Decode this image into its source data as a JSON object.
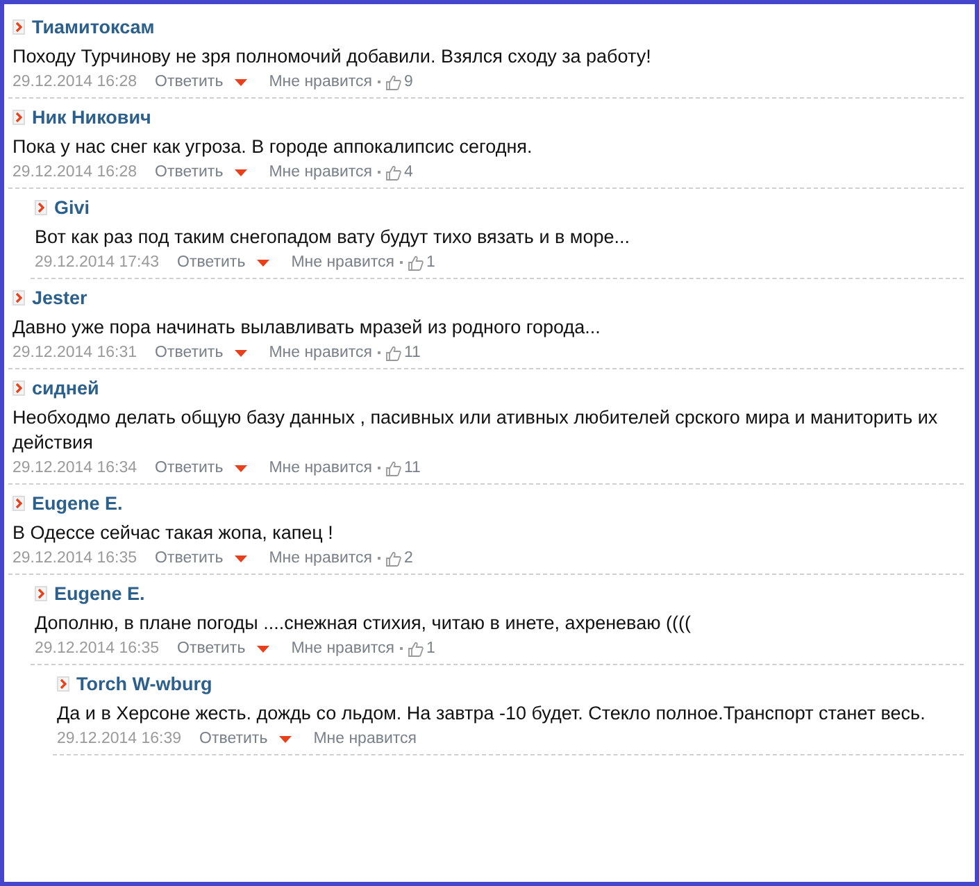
{
  "comments": [
    {
      "author": "Тиамитоксам",
      "text": "Походу Турчинову не зря полномочий добавили. Взялся сходу за работу!",
      "date": "29.12.2014 16:28",
      "reply": "Ответить",
      "like": "Мне нравится",
      "likes": "9"
    },
    {
      "author": "Ник Никович",
      "text": "Пока у нас снег как угроза. В городе аппокалипсис сегодня.",
      "date": "29.12.2014 16:28",
      "reply": "Ответить",
      "like": "Мне нравится",
      "likes": "4",
      "children": [
        {
          "author": "Givi",
          "text": "Вот как раз под таким снегопадом вату будут тихо вязать и в море...",
          "date": "29.12.2014 17:43",
          "reply": "Ответить",
          "like": "Мне нравится",
          "likes": "1"
        }
      ]
    },
    {
      "author": "Jester",
      "text": "Давно уже пора начинать вылавливать мразей из родного города...",
      "date": "29.12.2014 16:31",
      "reply": "Ответить",
      "like": "Мне нравится",
      "likes": "11"
    },
    {
      "author": "сидней",
      "text": "Необходмо делать общую базу данных , пасивных или ативных любителей срского мира и маниторить их действия",
      "date": "29.12.2014 16:34",
      "reply": "Ответить",
      "like": "Мне нравится",
      "likes": "11"
    },
    {
      "author": "Eugene E.",
      "text": "В Одессе сейчас такая жопа, капец !",
      "date": "29.12.2014 16:35",
      "reply": "Ответить",
      "like": "Мне нравится",
      "likes": "2",
      "children": [
        {
          "author": "Eugene E.",
          "text": "Дополню, в плане погоды ....снежная стихия, читаю в инете, ахреневаю ((((",
          "date": "29.12.2014 16:35",
          "reply": "Ответить",
          "like": "Мне нравится",
          "likes": "1",
          "children": [
            {
              "author": "Torch W-wburg",
              "text": "Да и в Херсоне жесть. дождь со льдом. На завтра -10 будет. Стекло полное.Транспорт станет весь.",
              "date": "29.12.2014 16:39",
              "reply": "Ответить",
              "like": "Мне нравится"
            }
          ]
        }
      ]
    }
  ]
}
